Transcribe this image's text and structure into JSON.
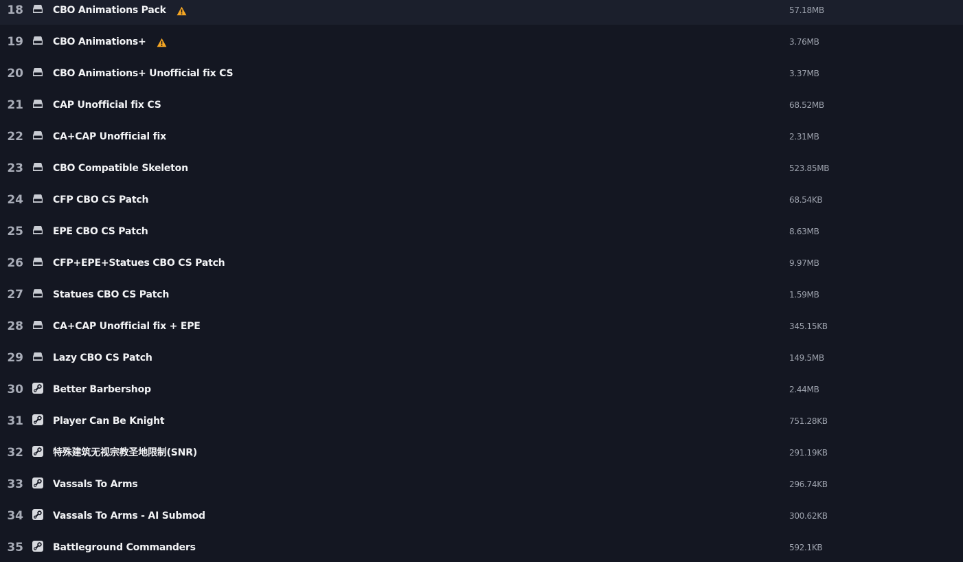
{
  "colors": {
    "background": "#141722",
    "index_text": "#a9adb8",
    "name_text": "#f2f3f5",
    "size_text": "#9ea3ae",
    "warning": "#f5a623"
  },
  "mods": [
    {
      "index": "18",
      "source_icon": "local-drive-icon",
      "name": "CBO Animations Pack",
      "size": "57.18MB",
      "warning": true
    },
    {
      "index": "19",
      "source_icon": "local-drive-icon",
      "name": "CBO Animations+",
      "size": "3.76MB",
      "warning": true
    },
    {
      "index": "20",
      "source_icon": "local-drive-icon",
      "name": "CBO Animations+ Unofficial fix CS",
      "size": "3.37MB",
      "warning": false
    },
    {
      "index": "21",
      "source_icon": "local-drive-icon",
      "name": "CAP Unofficial fix CS",
      "size": "68.52MB",
      "warning": false
    },
    {
      "index": "22",
      "source_icon": "local-drive-icon",
      "name": "CA+CAP Unofficial fix",
      "size": "2.31MB",
      "warning": false
    },
    {
      "index": "23",
      "source_icon": "local-drive-icon",
      "name": "CBO Compatible Skeleton",
      "size": "523.85MB",
      "warning": false
    },
    {
      "index": "24",
      "source_icon": "local-drive-icon",
      "name": "CFP CBO CS Patch",
      "size": "68.54KB",
      "warning": false
    },
    {
      "index": "25",
      "source_icon": "local-drive-icon",
      "name": "EPE CBO CS Patch",
      "size": "8.63MB",
      "warning": false
    },
    {
      "index": "26",
      "source_icon": "local-drive-icon",
      "name": "CFP+EPE+Statues CBO CS Patch",
      "size": "9.97MB",
      "warning": false
    },
    {
      "index": "27",
      "source_icon": "local-drive-icon",
      "name": "Statues CBO CS Patch",
      "size": "1.59MB",
      "warning": false
    },
    {
      "index": "28",
      "source_icon": "local-drive-icon",
      "name": "CA+CAP Unofficial fix + EPE",
      "size": "345.15KB",
      "warning": false
    },
    {
      "index": "29",
      "source_icon": "local-drive-icon",
      "name": "Lazy CBO CS Patch",
      "size": "149.5MB",
      "warning": false
    },
    {
      "index": "30",
      "source_icon": "steam-icon",
      "name": "Better Barbershop",
      "size": "2.44MB",
      "warning": false
    },
    {
      "index": "31",
      "source_icon": "steam-icon",
      "name": "Player Can Be Knight",
      "size": "751.28KB",
      "warning": false
    },
    {
      "index": "32",
      "source_icon": "steam-icon",
      "name": "特殊建筑无视宗教圣地限制(SNR)",
      "size": "291.19KB",
      "warning": false
    },
    {
      "index": "33",
      "source_icon": "steam-icon",
      "name": "Vassals To Arms",
      "size": "296.74KB",
      "warning": false
    },
    {
      "index": "34",
      "source_icon": "steam-icon",
      "name": "Vassals To Arms - AI Submod",
      "size": "300.62KB",
      "warning": false
    },
    {
      "index": "35",
      "source_icon": "steam-icon",
      "name": "Battleground Commanders",
      "size": "592.1KB",
      "warning": false
    }
  ]
}
